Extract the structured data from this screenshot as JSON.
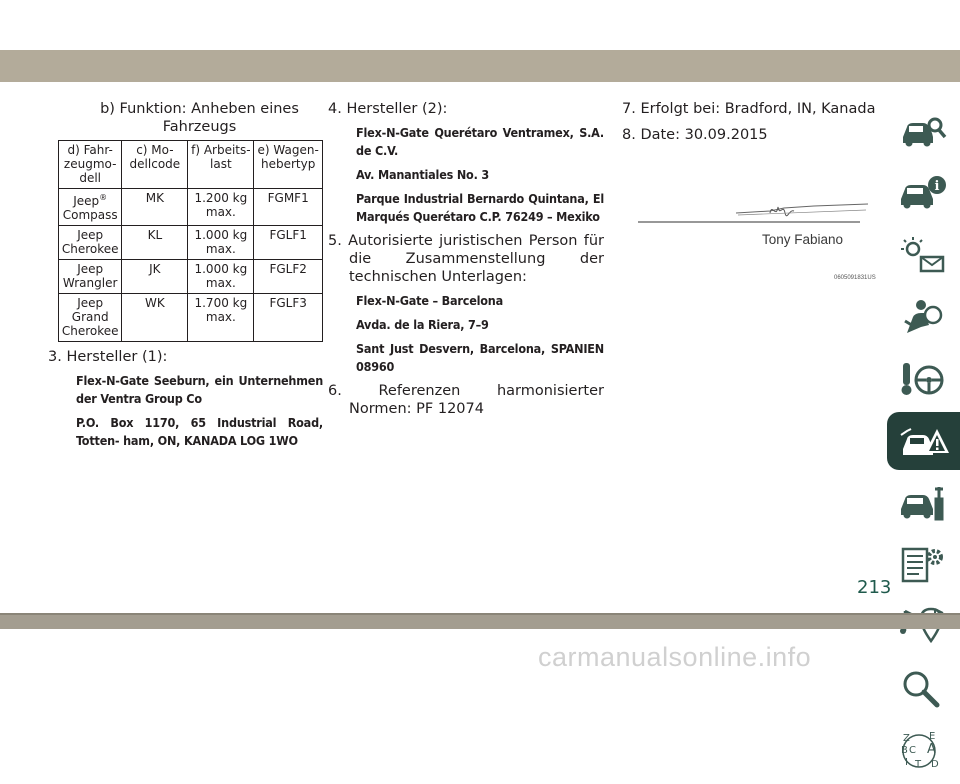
{
  "col1": {
    "caption": "b) Funktion: Anheben eines Fahrzeugs",
    "table": {
      "headers": [
        "d) Fahr- zeugmo- dell",
        "c) Mo- dellcode",
        "f) Arbeits- last",
        "e) Wagen- hebertyp"
      ],
      "rows": [
        {
          "model": "Jeep",
          "model_sup": "®",
          "model_2": "Compass",
          "code": "MK",
          "load": "1.200 kg max.",
          "type": "FGMF1"
        },
        {
          "model": "Jeep",
          "model_sup": "",
          "model_2": "Cherokee",
          "code": "KL",
          "load": "1.000 kg max.",
          "type": "FGLF1"
        },
        {
          "model": "Jeep",
          "model_sup": "",
          "model_2": "Wrangler",
          "code": "JK",
          "load": "1.000 kg max.",
          "type": "FGLF2"
        },
        {
          "model": "Jeep Grand",
          "model_sup": "",
          "model_2": "Cherokee",
          "code": "WK",
          "load": "1.700 kg max.",
          "type": "FGLF3"
        }
      ]
    },
    "item3": "3. Hersteller (1):",
    "item3_bold1": "Flex-N-Gate Seeburn, ein Unternehmen der Ventra Group Co",
    "item3_bold2": "P.O. Box 1170, 65 Industrial Road, Totten- ham, ON, KANADA LOG 1WO"
  },
  "col2": {
    "item4": "4. Hersteller (2):",
    "item4_bold1": "Flex-N-Gate Querétaro Ventramex, S.A. de C.V.",
    "item4_bold2": "Av. Manantiales No. 3",
    "item4_bold3": "Parque Industrial Bernardo Quintana, El Marqués Querétaro C.P. 76249 – Mexiko",
    "item5": "5. Autorisierte juristischen Person für die Zusammenstellung der technischen Unterlagen:",
    "item5_bold1": "Flex-N-Gate – Barcelona",
    "item5_bold2": "Avda. de la Riera, 7–9",
    "item5_bold3": "Sant Just Desvern, Barcelona, SPANIEN 08960",
    "item6": "6. Referenzen harmonisierter Normen: PF 12074"
  },
  "col3": {
    "item7": "7. Erfolgt bei: Bradford, IN, Kanada",
    "item8": "8. Date: 30.09.2015",
    "signature_name": "Tony Fabiano",
    "signature_code": "0605091831US"
  },
  "side_tabs": [
    {
      "icon": "car-magnifier-icon"
    },
    {
      "icon": "car-info-icon"
    },
    {
      "icon": "warning-lights-icon"
    },
    {
      "icon": "airbag-person-icon"
    },
    {
      "icon": "key-steering-wheel-icon"
    },
    {
      "icon": "car-hazard-icon",
      "active": true
    },
    {
      "icon": "car-wrench-icon"
    },
    {
      "icon": "list-gear-icon"
    },
    {
      "icon": "music-navigation-icon"
    },
    {
      "icon": "search-icon"
    },
    {
      "icon": "alphabet-index-icon",
      "letters": [
        "Z",
        "E",
        "B",
        "A",
        "C",
        "I",
        "T",
        "D"
      ]
    }
  ],
  "page_number": "213",
  "watermark": "carmanualsonline.info",
  "colors": {
    "band": "#b3ab9a",
    "tab_active": "#25403a",
    "page_number": "#1f5a4c",
    "text": "#231f20"
  }
}
